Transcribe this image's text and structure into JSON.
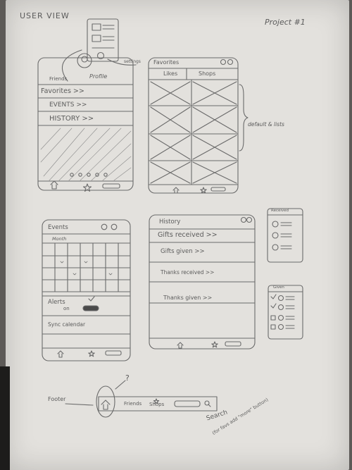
{
  "page": {
    "title": "USER VIEW",
    "project": "Project #1"
  },
  "user_view": {
    "friends_label": "Friends",
    "profile_label": "Profile",
    "menu": [
      "Favorites >>",
      "EVENTS >>",
      "HISTORY >>"
    ]
  },
  "callouts": {
    "settings": "settings",
    "default_list": "default & lists"
  },
  "favorites_view": {
    "title": "Favorites",
    "tabs": [
      "Likes",
      "Shops"
    ]
  },
  "events_view": {
    "title": "Events",
    "month": "Month",
    "alerts_label": "Alerts",
    "alerts_state": "on",
    "sync_label": "Sync calendar"
  },
  "history_view": {
    "title": "History",
    "items": [
      "Gifts received >>",
      "Gifts given >>",
      "Thanks received >>",
      "Thanks given >>"
    ]
  },
  "side_widgets": {
    "received_title": "Received",
    "given_title": "Given"
  },
  "footer_bar": {
    "label": "Footer",
    "friends": "Friends",
    "shops": "Shops",
    "search_note_line1": "Search",
    "search_note_line2": "(for favs add \"more\" button)",
    "question_mark": "?"
  },
  "icons": {
    "home": "home-icon",
    "star": "star-icon",
    "search": "search-icon",
    "gear": "gear-icon",
    "avatar": "avatar-icon"
  },
  "colors": {
    "pencil": "#5b5b5b",
    "paper": "#e3e1dd",
    "backdrop": "#5d5a57"
  }
}
